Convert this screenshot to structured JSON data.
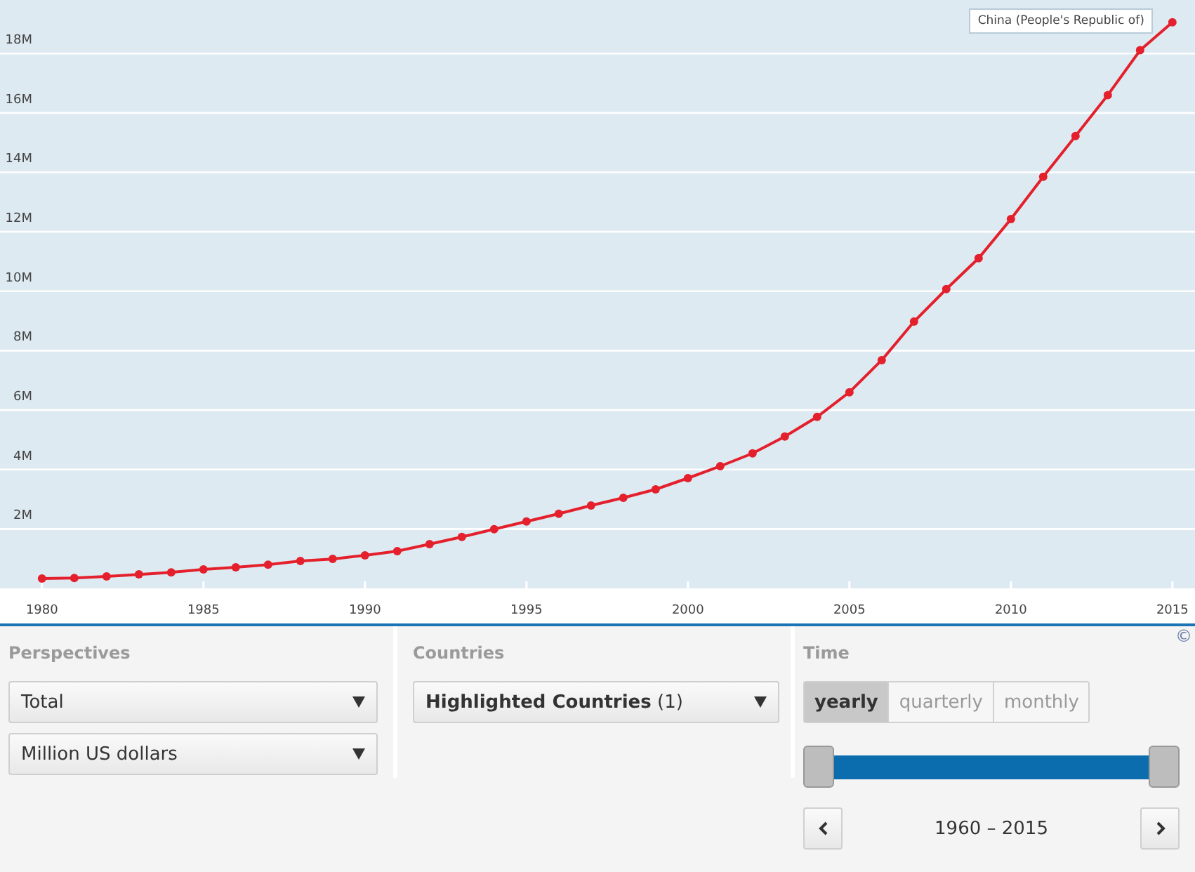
{
  "chart_data": {
    "type": "line",
    "x": [
      1980,
      1981,
      1982,
      1983,
      1984,
      1985,
      1986,
      1987,
      1988,
      1989,
      1990,
      1991,
      1992,
      1993,
      1994,
      1995,
      1996,
      1997,
      1998,
      1999,
      2000,
      2001,
      2002,
      2003,
      2004,
      2005,
      2006,
      2007,
      2008,
      2009,
      2010,
      2011,
      2012,
      2013,
      2014,
      2015
    ],
    "series": [
      {
        "name": "China (People's Republic of)",
        "color": "#e3202c",
        "marker": "circle",
        "values": [
          0.33,
          0.35,
          0.4,
          0.47,
          0.54,
          0.64,
          0.71,
          0.8,
          0.92,
          0.99,
          1.11,
          1.25,
          1.49,
          1.73,
          1.99,
          2.25,
          2.51,
          2.79,
          3.05,
          3.33,
          3.71,
          4.11,
          4.54,
          5.11,
          5.77,
          6.6,
          7.68,
          8.98,
          10.07,
          11.11,
          12.43,
          13.85,
          15.22,
          16.6,
          18.11,
          19.05
        ]
      }
    ],
    "xlim": [
      1978.7,
      2015.7
    ],
    "ylim": [
      0,
      19.8
    ],
    "grid": true,
    "xticks": [
      1980,
      1985,
      1990,
      1995,
      2000,
      2005,
      2010,
      2015
    ],
    "yticks": [
      {
        "value": 2,
        "label": "2M"
      },
      {
        "value": 4,
        "label": "4M"
      },
      {
        "value": 6,
        "label": "6M"
      },
      {
        "value": 8,
        "label": "8M"
      },
      {
        "value": 10,
        "label": "10M"
      },
      {
        "value": 12,
        "label": "12M"
      },
      {
        "value": 14,
        "label": "14M"
      },
      {
        "value": 16,
        "label": "16M"
      },
      {
        "value": 18,
        "label": "18M"
      }
    ]
  },
  "copyright": "©",
  "perspectives": {
    "heading": "Perspectives",
    "dropdowns": [
      {
        "value": "Total"
      },
      {
        "value": "Million US dollars"
      }
    ]
  },
  "countries": {
    "heading": "Countries",
    "dropdowns": [
      {
        "value": "**Highlighted Countries** (1)"
      }
    ]
  },
  "time": {
    "heading": "Time",
    "frequencies": [
      {
        "label": "yearly",
        "selected": true
      },
      {
        "label": "quarterly",
        "selected": false
      },
      {
        "label": "monthly",
        "selected": false
      }
    ],
    "slider_handles": [
      {
        "level": 0
      },
      {
        "level": 1
      }
    ],
    "range_label": "1960 – 2015"
  }
}
